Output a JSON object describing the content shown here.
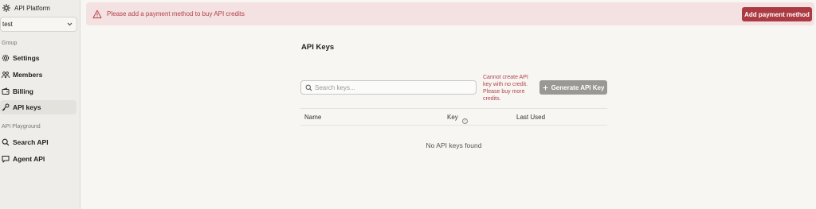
{
  "sidebar": {
    "brand": "API Platform",
    "project": "test",
    "group_label": "Group",
    "items": [
      {
        "label": "Settings",
        "icon": "gear-icon"
      },
      {
        "label": "Members",
        "icon": "users-icon"
      },
      {
        "label": "Billing",
        "icon": "wallet-icon"
      },
      {
        "label": "API keys",
        "icon": "key-icon",
        "active": true
      }
    ],
    "playground_label": "API Playground",
    "playground_items": [
      {
        "label": "Search API",
        "icon": "search-icon"
      },
      {
        "label": "Agent API",
        "icon": "chat-icon"
      }
    ]
  },
  "banner": {
    "message": "Please add a payment method to buy API credits",
    "button": "Add payment method",
    "color": "#ac3a42"
  },
  "main": {
    "title": "API Keys",
    "search_placeholder": "Search keys...",
    "credit_warning": "Cannot create API key with no credit. Please buy more credits.",
    "generate_button": "Generate API Key",
    "table": {
      "columns": [
        "Name",
        "Key",
        "Last Used"
      ],
      "empty_text": "No API keys found"
    }
  }
}
